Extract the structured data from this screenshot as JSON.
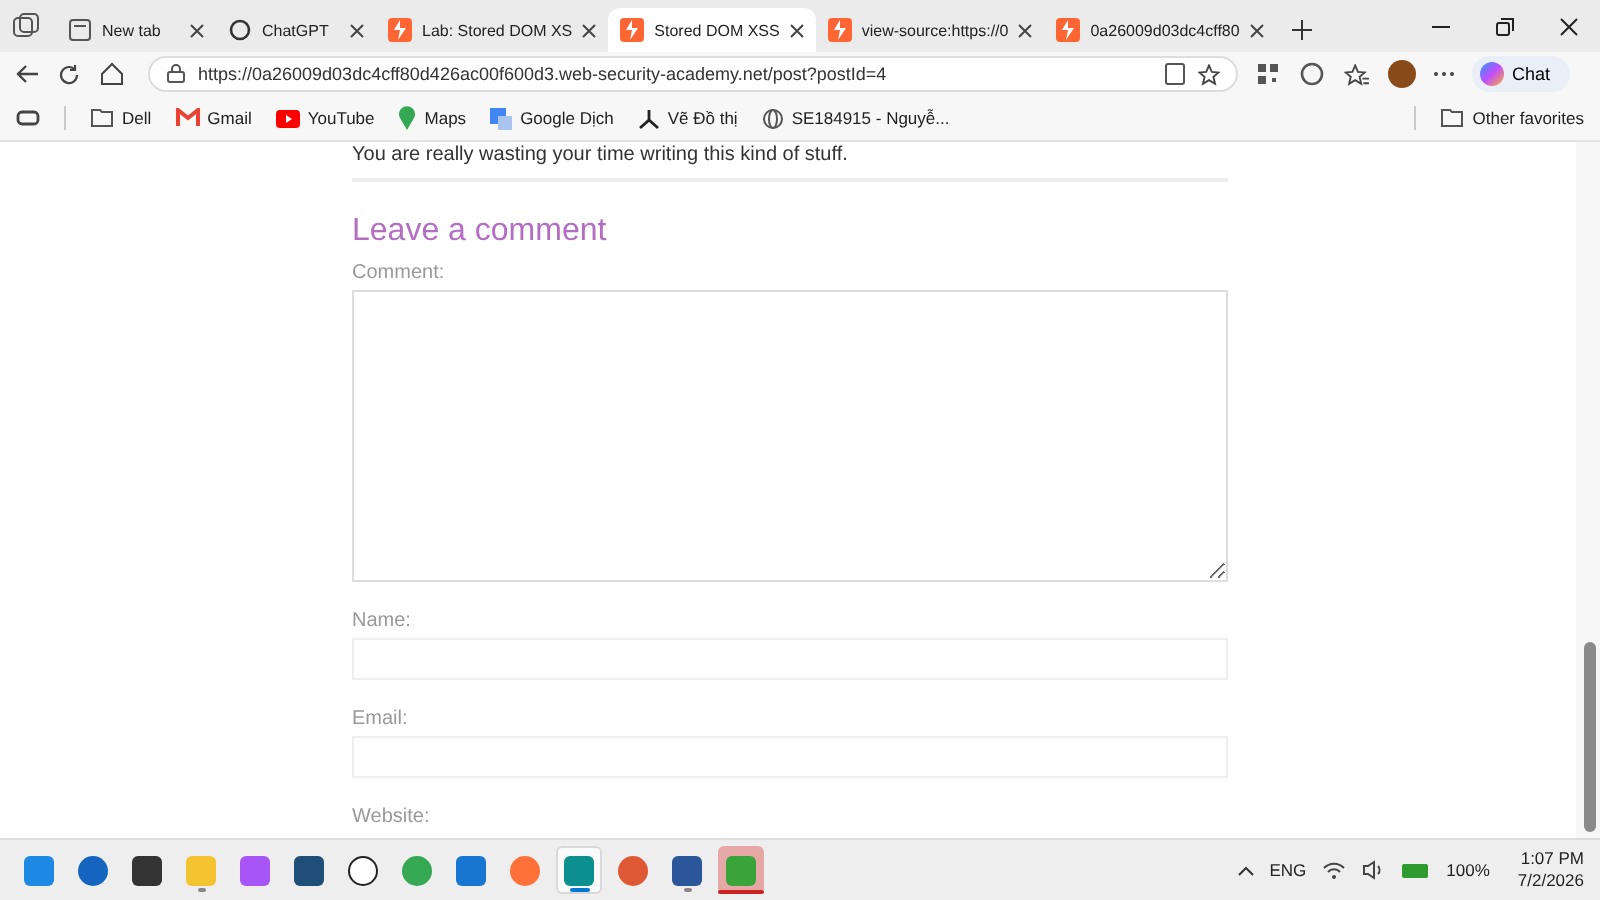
{
  "tabs": [
    {
      "label": "New tab",
      "kind": "page",
      "selected": false
    },
    {
      "label": "ChatGPT",
      "kind": "chat",
      "selected": false
    },
    {
      "label": "Lab: Stored DOM XS",
      "kind": "lab",
      "selected": false
    },
    {
      "label": "Stored DOM XSS",
      "kind": "lab",
      "selected": true
    },
    {
      "label": "view-source:https://0",
      "kind": "lab",
      "selected": false
    },
    {
      "label": "0a26009d03dc4cff80",
      "kind": "lab",
      "selected": false
    }
  ],
  "address": "https://0a26009d03dc4cff80d426ac00f600d3.web-security-academy.net/post?postId=4",
  "chat_button": "Chat",
  "bookmarks": [
    {
      "label": "Dell",
      "kind": "folder"
    },
    {
      "label": "Gmail",
      "kind": "gmail"
    },
    {
      "label": "YouTube",
      "kind": "youtube"
    },
    {
      "label": "Maps",
      "kind": "maps"
    },
    {
      "label": "Google Dịch",
      "kind": "translate"
    },
    {
      "label": "Vẽ Đồ thị",
      "kind": "graph"
    },
    {
      "label": "SE184915 - Nguyễ...",
      "kind": "globe"
    }
  ],
  "other_favorites": "Other favorites",
  "page": {
    "prev_comment": "You are really wasting your time writing this kind of stuff.",
    "heading": "Leave a comment",
    "comment_label": "Comment:",
    "name_label": "Name:",
    "email_label": "Email:",
    "website_label": "Website:"
  },
  "taskbar": [
    {
      "kind": "start",
      "running": false,
      "selected": false,
      "highlighted": false
    },
    {
      "kind": "search",
      "running": false,
      "selected": false,
      "highlighted": false
    },
    {
      "kind": "taskview",
      "running": false,
      "selected": false,
      "highlighted": false
    },
    {
      "kind": "files",
      "running": true,
      "selected": false,
      "highlighted": false
    },
    {
      "kind": "copilot",
      "running": false,
      "selected": false,
      "highlighted": false
    },
    {
      "kind": "store",
      "running": false,
      "selected": false,
      "highlighted": false
    },
    {
      "kind": "dell",
      "running": false,
      "selected": false,
      "highlighted": false
    },
    {
      "kind": "chrome",
      "running": false,
      "selected": false,
      "highlighted": false
    },
    {
      "kind": "mail",
      "running": false,
      "selected": false,
      "highlighted": false
    },
    {
      "kind": "firefox",
      "running": false,
      "selected": false,
      "highlighted": false
    },
    {
      "kind": "edge",
      "running": true,
      "selected": true,
      "highlighted": false
    },
    {
      "kind": "duck",
      "running": false,
      "selected": false,
      "highlighted": false
    },
    {
      "kind": "word",
      "running": true,
      "selected": false,
      "highlighted": false
    },
    {
      "kind": "idm",
      "running": true,
      "selected": false,
      "highlighted": true
    }
  ],
  "tray": {
    "lang": "ENG",
    "battery": "100%",
    "time": "1:07 PM",
    "date": "7/2/2026"
  }
}
